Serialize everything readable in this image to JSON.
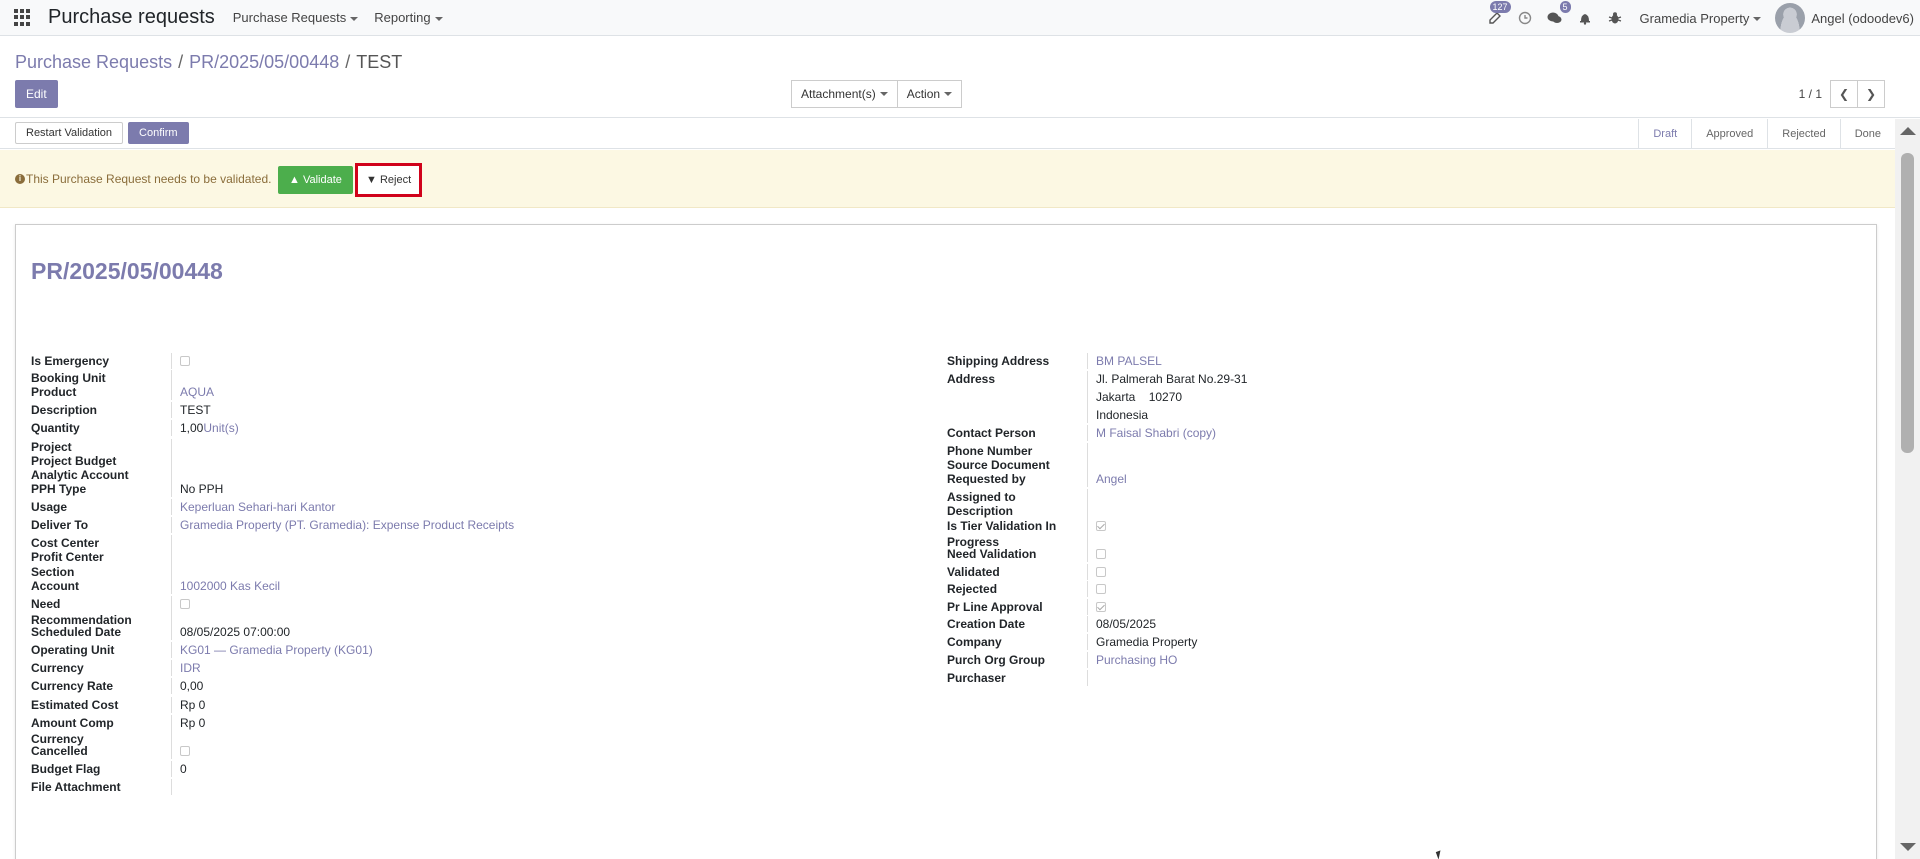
{
  "navbar": {
    "app_title": "Purchase requests",
    "menus": [
      "Purchase Requests",
      "Reporting"
    ],
    "activity_badge": "127",
    "messages_badge": "5",
    "company": "Gramedia Property",
    "user": "Angel (odoodev6)"
  },
  "control_panel": {
    "breadcrumb": [
      "Purchase Requests",
      "PR/2025/05/00448",
      "TEST"
    ],
    "edit_label": "Edit",
    "attachments_label": "Attachment(s)",
    "action_label": "Action",
    "pager": "1 / 1"
  },
  "statusbar": {
    "restart_label": "Restart Validation",
    "confirm_label": "Confirm",
    "stages": [
      "Draft",
      "Approved",
      "Rejected",
      "Done"
    ]
  },
  "alert": {
    "message": "This Purchase Request needs to be validated.",
    "validate_label": "Validate",
    "reject_label": "Reject"
  },
  "record": {
    "name": "PR/2025/05/00448",
    "left_fields": [
      {
        "label": "Is Emergency",
        "type": "checkbox",
        "checked": false
      },
      {
        "label": "Booking Unit",
        "value": ""
      },
      {
        "label": "Product",
        "value": "AQUA",
        "link": true
      },
      {
        "label": "Description",
        "value": "TEST"
      },
      {
        "label": "Quantity",
        "value": "1,00",
        "suffix": "Unit(s)"
      },
      {
        "label": "Project",
        "value": ""
      },
      {
        "label": "Project Budget",
        "value": ""
      },
      {
        "label": "Analytic Account",
        "value": ""
      },
      {
        "label": "PPH Type",
        "value": "No PPH"
      },
      {
        "label": "Usage",
        "value": "Keperluan Sehari-hari Kantor",
        "link": true
      },
      {
        "label": "Deliver To",
        "value": "Gramedia Property (PT. Gramedia): Expense Product Receipts",
        "link": true
      },
      {
        "label": "Cost Center",
        "value": ""
      },
      {
        "label": "Profit Center",
        "value": ""
      },
      {
        "label": "Section",
        "value": ""
      },
      {
        "label": "Account",
        "value": "1002000 Kas Kecil",
        "link": true
      },
      {
        "label": "Need Recommendation",
        "type": "checkbox",
        "checked": false
      },
      {
        "label": "Scheduled Date",
        "value": "08/05/2025 07:00:00"
      },
      {
        "label": "Operating Unit",
        "value": "KG01 — Gramedia Property (KG01)",
        "link": true
      },
      {
        "label": "Currency",
        "value": "IDR",
        "link": true
      },
      {
        "label": "Currency Rate",
        "value": "0,00"
      },
      {
        "label": "Estimated Cost",
        "value": "Rp 0"
      },
      {
        "label": "Amount Comp Currency",
        "value": "Rp 0"
      },
      {
        "label": "Cancelled",
        "type": "checkbox",
        "checked": false
      },
      {
        "label": "Budget Flag",
        "value": "0"
      },
      {
        "label": "File Attachment",
        "value": ""
      }
    ],
    "right_fields": [
      {
        "label": "Shipping Address",
        "value": "BM PALSEL",
        "link": true
      },
      {
        "label": "Address",
        "lines": [
          "Jl. Palmerah Barat No.29-31",
          "Jakarta    10270",
          "Indonesia"
        ]
      },
      {
        "label": "Contact Person",
        "value": "M Faisal Shabri (copy)",
        "link": true
      },
      {
        "label": "Phone Number",
        "value": ""
      },
      {
        "label": "Source Document",
        "value": ""
      },
      {
        "label": "Requested by",
        "value": "Angel",
        "link": true
      },
      {
        "label": "Assigned to",
        "value": ""
      },
      {
        "label": "Description",
        "value": ""
      },
      {
        "label": "Is Tier Validation In Progress",
        "type": "checkbox",
        "checked": true
      },
      {
        "label": "Need Validation",
        "type": "checkbox",
        "checked": false
      },
      {
        "label": "Validated",
        "type": "checkbox",
        "checked": false
      },
      {
        "label": "Rejected",
        "type": "checkbox",
        "checked": false
      },
      {
        "label": "Pr Line Approval",
        "type": "checkbox",
        "checked": true
      },
      {
        "label": "Creation Date",
        "value": "08/05/2025"
      },
      {
        "label": "Company",
        "value": "Gramedia Property"
      },
      {
        "label": "Purch Org Group",
        "value": "Purchasing HO",
        "link": true
      },
      {
        "label": "Purchaser",
        "value": ""
      }
    ]
  },
  "colors": {
    "primary": "#7c7bad",
    "success": "#4cae4c",
    "alert_bg": "#fcf8e3",
    "highlight": "#d0021b"
  }
}
